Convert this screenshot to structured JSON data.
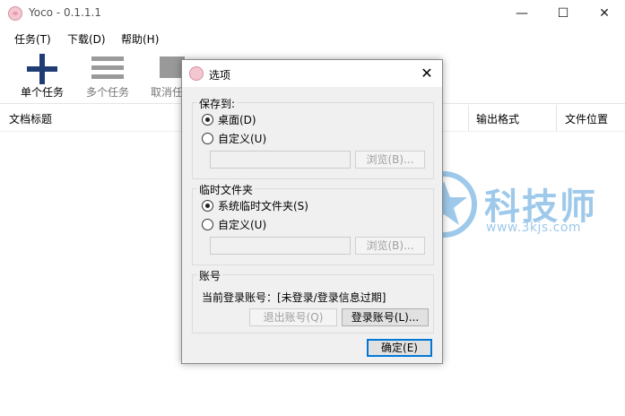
{
  "window": {
    "title": "Yoco - 0.1.1.1",
    "minimize_glyph": "—",
    "maximize_glyph": "☐",
    "close_glyph": "✕"
  },
  "menu": [
    {
      "label": "任务(T)"
    },
    {
      "label": "下载(D)"
    },
    {
      "label": "帮助(H)"
    }
  ],
  "toolbar": {
    "items": [
      {
        "label": "单个任务",
        "icon": "plus-icon"
      },
      {
        "label": "多个任务",
        "icon": "list-icon"
      },
      {
        "label": "取消任务",
        "icon": "cancel-icon"
      }
    ]
  },
  "table": {
    "columns": [
      "文档标题",
      "输出格式",
      "文件位置"
    ]
  },
  "dialog": {
    "title": "选项",
    "close_glyph": "✕",
    "save_to": {
      "title": "保存到:",
      "option_desktop": "桌面(D)",
      "option_custom": "自定义(U)",
      "path_value": "",
      "browse_label": "浏览(B)..."
    },
    "temp_folder": {
      "title": "临时文件夹",
      "option_system": "系统临时文件夹(S)",
      "option_custom": "自定义(U)",
      "path_value": "",
      "browse_label": "浏览(B)..."
    },
    "account": {
      "title": "账号",
      "status_text": "当前登录账号：[未登录/登录信息过期]",
      "logout_label": "退出账号(Q)",
      "login_label": "登录账号(L)..."
    },
    "ok_label": "确定(E)"
  },
  "watermark": {
    "brand": "科技师",
    "url": "www.3kjs.com"
  },
  "colors": {
    "accent": "#0078d7",
    "toolbar_icon": "#1f3d73",
    "watermark": "#9ec9ea"
  }
}
